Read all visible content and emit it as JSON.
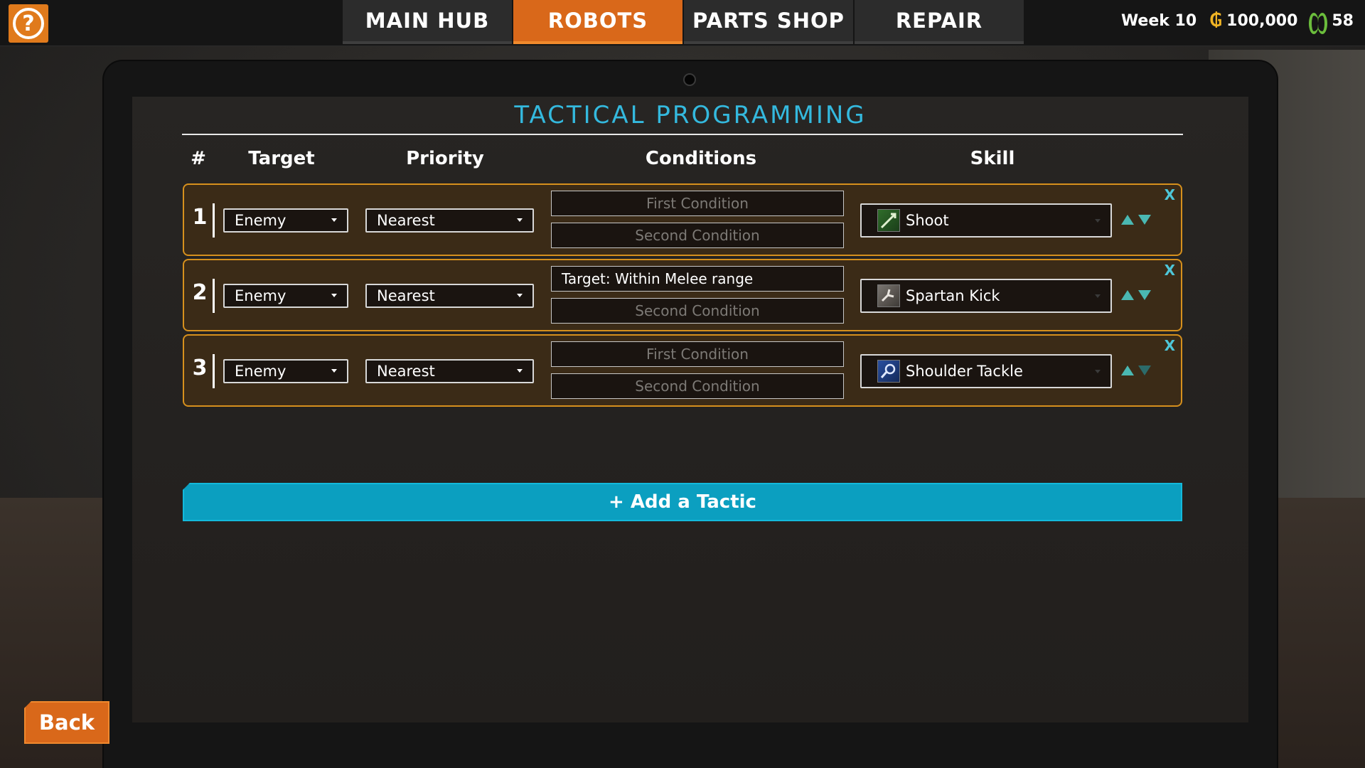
{
  "topbar": {
    "help_label": "?",
    "tabs": [
      {
        "label": "MAIN HUB",
        "active": false
      },
      {
        "label": "ROBOTS",
        "active": true
      },
      {
        "label": "PARTS SHOP",
        "active": false
      },
      {
        "label": "REPAIR",
        "active": false
      }
    ],
    "week": "Week 10",
    "currency_icon": "coin-icon",
    "money": "100,000",
    "fame_icon": "laurel-icon",
    "fame": "58"
  },
  "screen": {
    "title": "TACTICAL PROGRAMMING",
    "columns": {
      "num": "#",
      "target": "Target",
      "priority": "Priority",
      "conditions": "Conditions",
      "skill": "Skill"
    },
    "rows": [
      {
        "num": "1",
        "target": "Enemy",
        "priority": "Nearest",
        "first_condition": "First Condition",
        "second_condition": "Second Condition",
        "skill": "Shoot",
        "skill_icon": "shoot-icon",
        "remove": "X"
      },
      {
        "num": "2",
        "target": "Enemy",
        "priority": "Nearest",
        "first_condition": "Target: Within Melee range",
        "second_condition": "Second Condition",
        "skill": "Spartan Kick",
        "skill_icon": "kick-icon",
        "remove": "X"
      },
      {
        "num": "3",
        "target": "Enemy",
        "priority": "Nearest",
        "first_condition": "First Condition",
        "second_condition": "Second Condition",
        "skill": "Shoulder Tackle",
        "skill_icon": "tackle-icon",
        "remove": "X"
      }
    ],
    "add_tactic": "+ Add a Tactic"
  },
  "back_label": "Back",
  "colors": {
    "accent_orange": "#d9681a",
    "title_cyan": "#34b9de",
    "row_border": "#d6901d",
    "add_button": "#0b9fc0"
  }
}
